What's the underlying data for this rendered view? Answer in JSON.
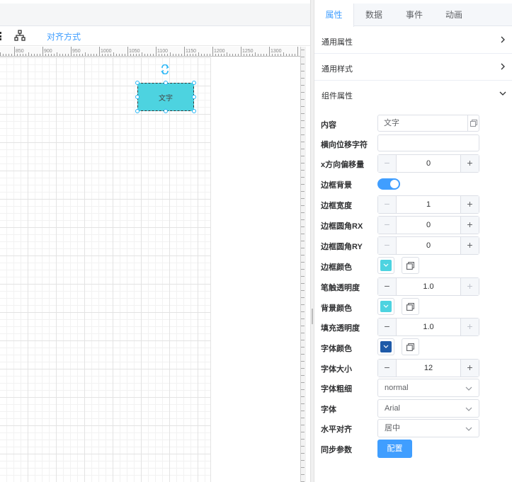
{
  "toolbar": {
    "align_label": "对齐方式"
  },
  "ruler": {
    "ticks": [
      "850",
      "900",
      "950",
      "1000",
      "1050",
      "1100",
      "1150",
      "1200",
      "1250",
      "1300"
    ]
  },
  "canvas": {
    "shape_text": "文字",
    "shape_color": "#4dd3e0"
  },
  "tabs": [
    {
      "label": "属性",
      "active": true
    },
    {
      "label": "数据",
      "active": false
    },
    {
      "label": "事件",
      "active": false
    },
    {
      "label": "动画",
      "active": false
    }
  ],
  "sections": {
    "general_props": "通用属性",
    "general_style": "通用样式",
    "component_props": "组件属性"
  },
  "props": {
    "content": {
      "label": "内容",
      "value": "文字"
    },
    "h_offset_char": {
      "label": "横向位移字符",
      "value": ""
    },
    "x_offset": {
      "label": "x方向偏移量",
      "value": "0"
    },
    "border_bg": {
      "label": "边框背景",
      "on": true
    },
    "border_width": {
      "label": "边框宽度",
      "value": "1"
    },
    "radius_rx": {
      "label": "边框圆角RX",
      "value": "0"
    },
    "radius_ry": {
      "label": "边框圆角RY",
      "value": "0"
    },
    "border_color": {
      "label": "边框颜色",
      "color": "#4dd3e0"
    },
    "stroke_opacity": {
      "label": "笔触透明度",
      "value": "1.0"
    },
    "bg_color": {
      "label": "背景颜色",
      "color": "#4dd3e0"
    },
    "fill_opacity": {
      "label": "填充透明度",
      "value": "1.0"
    },
    "font_color": {
      "label": "字体颜色",
      "color": "#1e5aa8"
    },
    "font_size": {
      "label": "字体大小",
      "value": "12"
    },
    "font_weight": {
      "label": "字体粗细",
      "value": "normal"
    },
    "font_family": {
      "label": "字体",
      "value": "Arial"
    },
    "h_align": {
      "label": "水平对齐",
      "value": "居中"
    },
    "sync_params": {
      "label": "同步参数",
      "button": "配置"
    }
  },
  "colors": {
    "accent": "#409eff",
    "border": "#dcdfe6"
  }
}
